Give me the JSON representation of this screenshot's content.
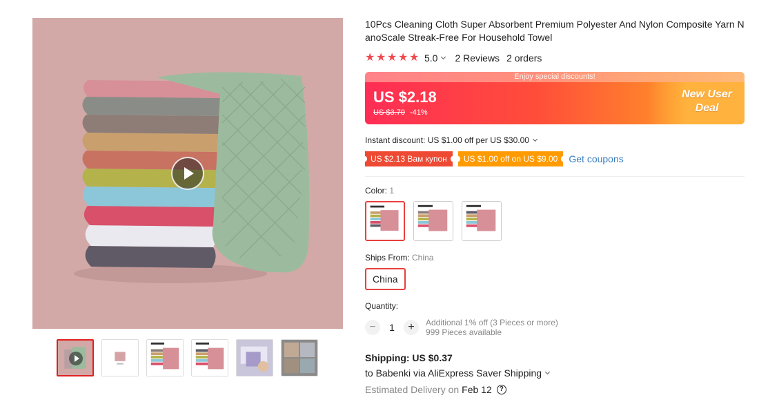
{
  "gallery": {
    "thumbnails": [
      {
        "name": "thumb-video"
      },
      {
        "name": "thumb-single-cloth"
      },
      {
        "name": "thumb-pack-25"
      },
      {
        "name": "thumb-pack-30"
      },
      {
        "name": "thumb-lifestyle-1"
      },
      {
        "name": "thumb-lifestyle-2"
      }
    ]
  },
  "product": {
    "title": "10Pcs Cleaning Cloth Super Absorbent Premium Polyester And Nylon Composite Yarn NanoScale Streak-Free For Household Towel",
    "rating": "5.0",
    "reviews": "2 Reviews",
    "orders": "2 orders"
  },
  "price": {
    "banner_text": "Enjoy special discounts!",
    "current": "US $2.18",
    "original": "US $3.70",
    "discount": "-41%",
    "deal_line1": "New User",
    "deal_line2": "Deal"
  },
  "discounts": {
    "instant": "Instant discount: US $1.00 off per US $30.00",
    "coupon1": "US $2.13 Вам купон",
    "coupon2": "US $1.00 off on US $9.00",
    "get_coupons": "Get coupons"
  },
  "options": {
    "color_label": "Color: ",
    "color_value": "1",
    "ships_label": "Ships From: ",
    "ships_value": "China",
    "ships_option": "China"
  },
  "quantity": {
    "label": "Quantity:",
    "minus": "−",
    "value": "1",
    "plus": "+",
    "info1": "Additional 1% off (3 Pieces or more)",
    "info2": "999 Pieces available"
  },
  "shipping": {
    "cost": "Shipping: US $0.37",
    "via": "to Babenki via AliExpress Saver Shipping",
    "delivery_label": "Estimated Delivery on",
    "delivery_date": "Feb 12",
    "help": "?"
  },
  "colors": {
    "accent": "#e8403c",
    "star": "#f0484d",
    "link": "#3a7ebf",
    "image_bg": "#d2a9a7"
  }
}
